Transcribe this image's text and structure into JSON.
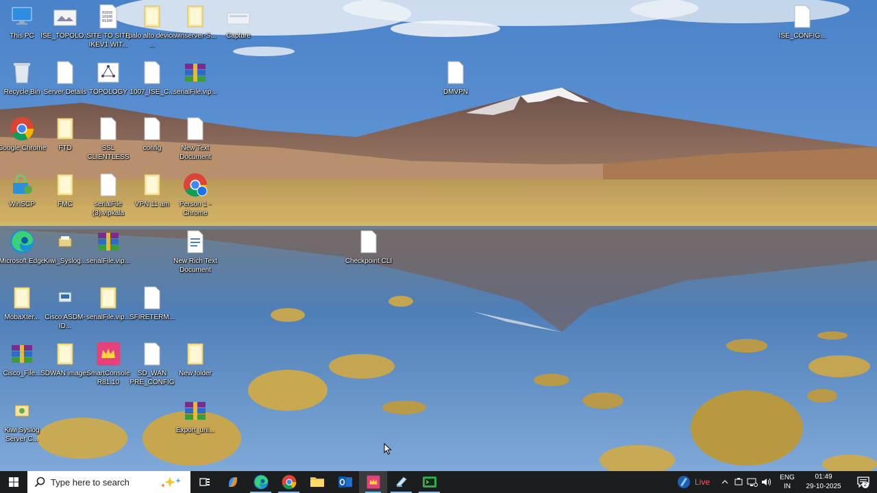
{
  "desktop": {
    "icons": [
      {
        "label": "This PC",
        "icon": "computer-icon"
      },
      {
        "label": "ISE_TOPOLO...",
        "icon": "image-file-icon"
      },
      {
        "label": "SITE TO SITE IKEV1 WIT...",
        "icon": "binary-file-icon"
      },
      {
        "label": "palo alto device ...",
        "icon": "folder-icon"
      },
      {
        "label": "winserver-S...",
        "icon": "folder-icon"
      },
      {
        "label": "Capture",
        "icon": "image-file-icon"
      },
      {
        "label": "ISE_CONFIG...",
        "icon": "text-file-icon"
      },
      {
        "label": "Recycle Bin",
        "icon": "recycle-bin-icon"
      },
      {
        "label": "Server Details",
        "icon": "text-file-icon"
      },
      {
        "label": "TOPOLOGY",
        "icon": "diagram-file-icon"
      },
      {
        "label": "1007_ISE_C...",
        "icon": "text-file-icon"
      },
      {
        "label": "serialFile.vip...",
        "icon": "winrar-archive-icon"
      },
      {
        "label": "DMVPN",
        "icon": "text-file-icon"
      },
      {
        "label": "Google Chrome",
        "icon": "chrome-icon"
      },
      {
        "label": "FTD",
        "icon": "folder-icon"
      },
      {
        "label": "SSL CLIENTLESS",
        "icon": "text-file-icon"
      },
      {
        "label": "config",
        "icon": "text-file-icon"
      },
      {
        "label": "New Text Document",
        "icon": "text-file-icon"
      },
      {
        "label": "WinSCP",
        "icon": "winscp-icon"
      },
      {
        "label": "FMC",
        "icon": "folder-icon"
      },
      {
        "label": "serialFile (3).vipkala",
        "icon": "text-file-icon"
      },
      {
        "label": "VPN 11 am",
        "icon": "folder-icon"
      },
      {
        "label": "Person 1 - Chrome",
        "icon": "chrome-profile-icon"
      },
      {
        "label": "Microsoft Edge",
        "icon": "edge-icon"
      },
      {
        "label": "Kiwi_Syslog...",
        "icon": "kiwi-syslog-installer-icon"
      },
      {
        "label": "serialFile.vip...",
        "icon": "winrar-archive-icon"
      },
      {
        "label": "New Rich Text Document",
        "icon": "rich-text-file-icon"
      },
      {
        "label": "Checkpoint CLI",
        "icon": "text-file-icon"
      },
      {
        "label": "MobaXter...",
        "icon": "folder-icon"
      },
      {
        "label": "Cisco ASDM-ID...",
        "icon": "cisco-asdm-icon"
      },
      {
        "label": "serialFile.vip...",
        "icon": "folder-icon"
      },
      {
        "label": "SFIRETERM...",
        "icon": "text-file-icon"
      },
      {
        "label": "Cisco_File...",
        "icon": "winrar-archive-icon"
      },
      {
        "label": "SDWAN images",
        "icon": "folder-icon"
      },
      {
        "label": "SmartConsole R81.10",
        "icon": "smartconsole-icon"
      },
      {
        "label": "SD_WAN PRE_CONFIG",
        "icon": "text-file-icon"
      },
      {
        "label": "New folder",
        "icon": "folder-icon"
      },
      {
        "label": "Export_uni...",
        "icon": "winrar-archive-icon"
      },
      {
        "label": "Kiwi Syslog Server C...",
        "icon": "kiwi-syslog-icon"
      }
    ]
  },
  "taskbar": {
    "search_placeholder": "Type here to search",
    "apps": [
      {
        "name": "task-view",
        "icon": "task-view-icon"
      },
      {
        "name": "copilot",
        "icon": "copilot-icon"
      },
      {
        "name": "edge",
        "icon": "edge-icon"
      },
      {
        "name": "chrome",
        "icon": "chrome-icon"
      },
      {
        "name": "file-explorer",
        "icon": "folder-icon"
      },
      {
        "name": "outlook",
        "icon": "outlook-icon"
      },
      {
        "name": "smartconsole",
        "icon": "smartconsole-icon"
      },
      {
        "name": "notes",
        "icon": "notepad-icon"
      },
      {
        "name": "terminal",
        "icon": "terminal-icon"
      }
    ],
    "live_label": "Live",
    "language": {
      "line1": "ENG",
      "line2": "IN"
    },
    "clock": {
      "time": "01:49",
      "date": "29-10-2025"
    },
    "notification_count": "2"
  },
  "colors": {
    "taskbar_bg": "#1c1d1f",
    "accent": "#76b9ed",
    "live_red": "#ff5a5a"
  }
}
